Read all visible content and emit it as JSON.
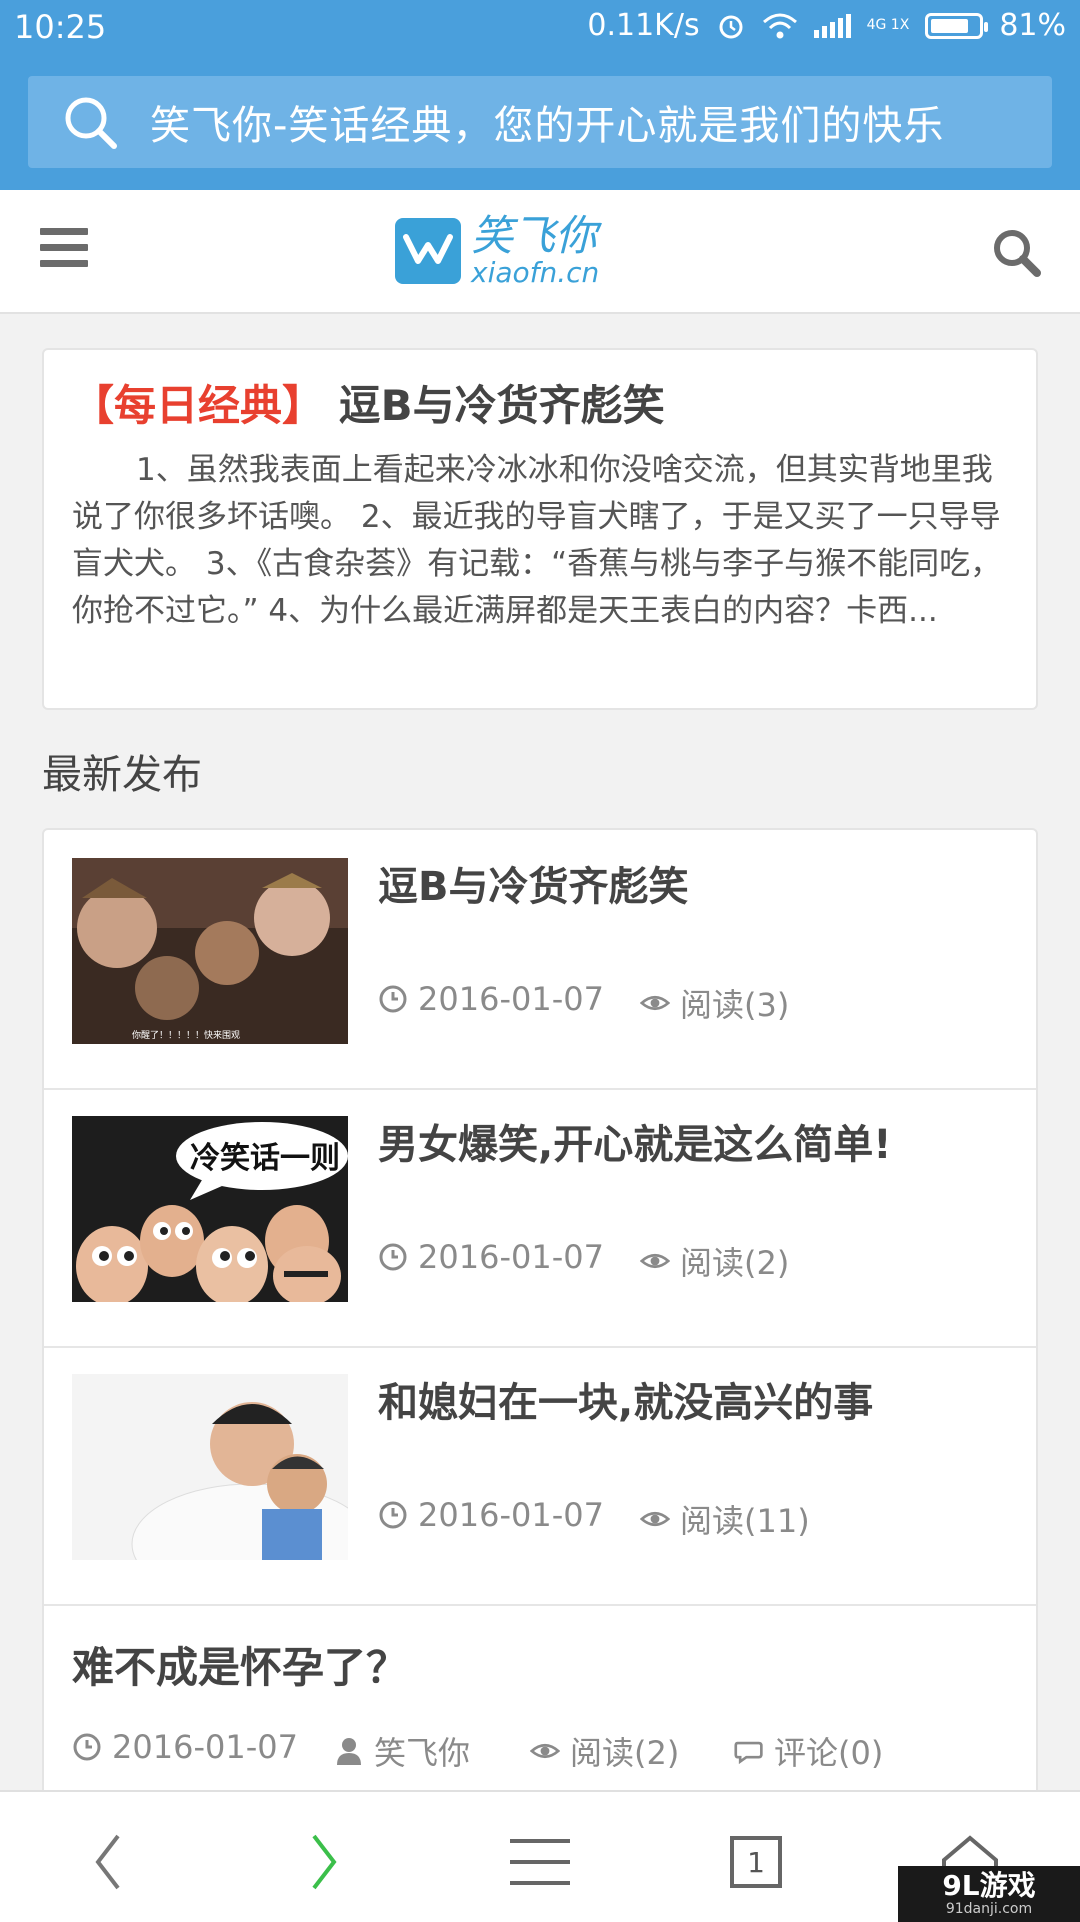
{
  "status_bar": {
    "time": "10:25",
    "speed": "0.11K/s",
    "network": "4G 1X",
    "battery": "81%",
    "battery_level": 0.81
  },
  "browser": {
    "search_text": "笑飞你-笑话经典，您的开心就是我们的快乐",
    "search_icon": "search-icon"
  },
  "site": {
    "logo_cn": "笑飞你",
    "logo_en": "xiaofn.cn",
    "menu_icon": "hamburger-menu-icon",
    "search_icon": "search-icon"
  },
  "featured": {
    "tag": "【每日经典】",
    "title": "逗B与冷货齐彪笑",
    "excerpt": "1、虽然我表面上看起来冷冰冰和你没啥交流，但其实背地里我说了你很多坏话噢。 2、最近我的导盲犬瞎了，于是又买了一只导导盲犬犬。 3、《古食杂荟》有记载：“香蕉与桃与李子与猴不能同吃，你抢不过它。” 4、为什么最近满屏都是天王表白的内容？卡西..."
  },
  "section": {
    "title": "最新发布"
  },
  "articles": [
    {
      "title": "逗B与冷货齐彪笑",
      "date": "2016-01-07",
      "views": "阅读(3)",
      "thumb_caption": "你醒了！！！！！快来围观"
    },
    {
      "title": "男女爆笑,开心就是这么简单!",
      "date": "2016-01-07",
      "views": "阅读(2)",
      "thumb_caption": "冷笑话一则"
    },
    {
      "title": "和媳妇在一块,就没高兴的事",
      "date": "2016-01-07",
      "views": "阅读(11)"
    },
    {
      "title": "难不成是怀孕了？",
      "date": "2016-01-07",
      "author": "笑飞你",
      "views": "阅读(2)",
      "comments": "评论(0)"
    }
  ],
  "bottom_nav": {
    "tab_count": "1",
    "watermark_big": "9L游戏",
    "watermark_small": "91danji.com"
  },
  "colors": {
    "browser_blue": "#4a9fdc",
    "accent_red": "#e8402f",
    "logo_blue": "#3aa1d8",
    "forward_green": "#3bbf4a"
  }
}
